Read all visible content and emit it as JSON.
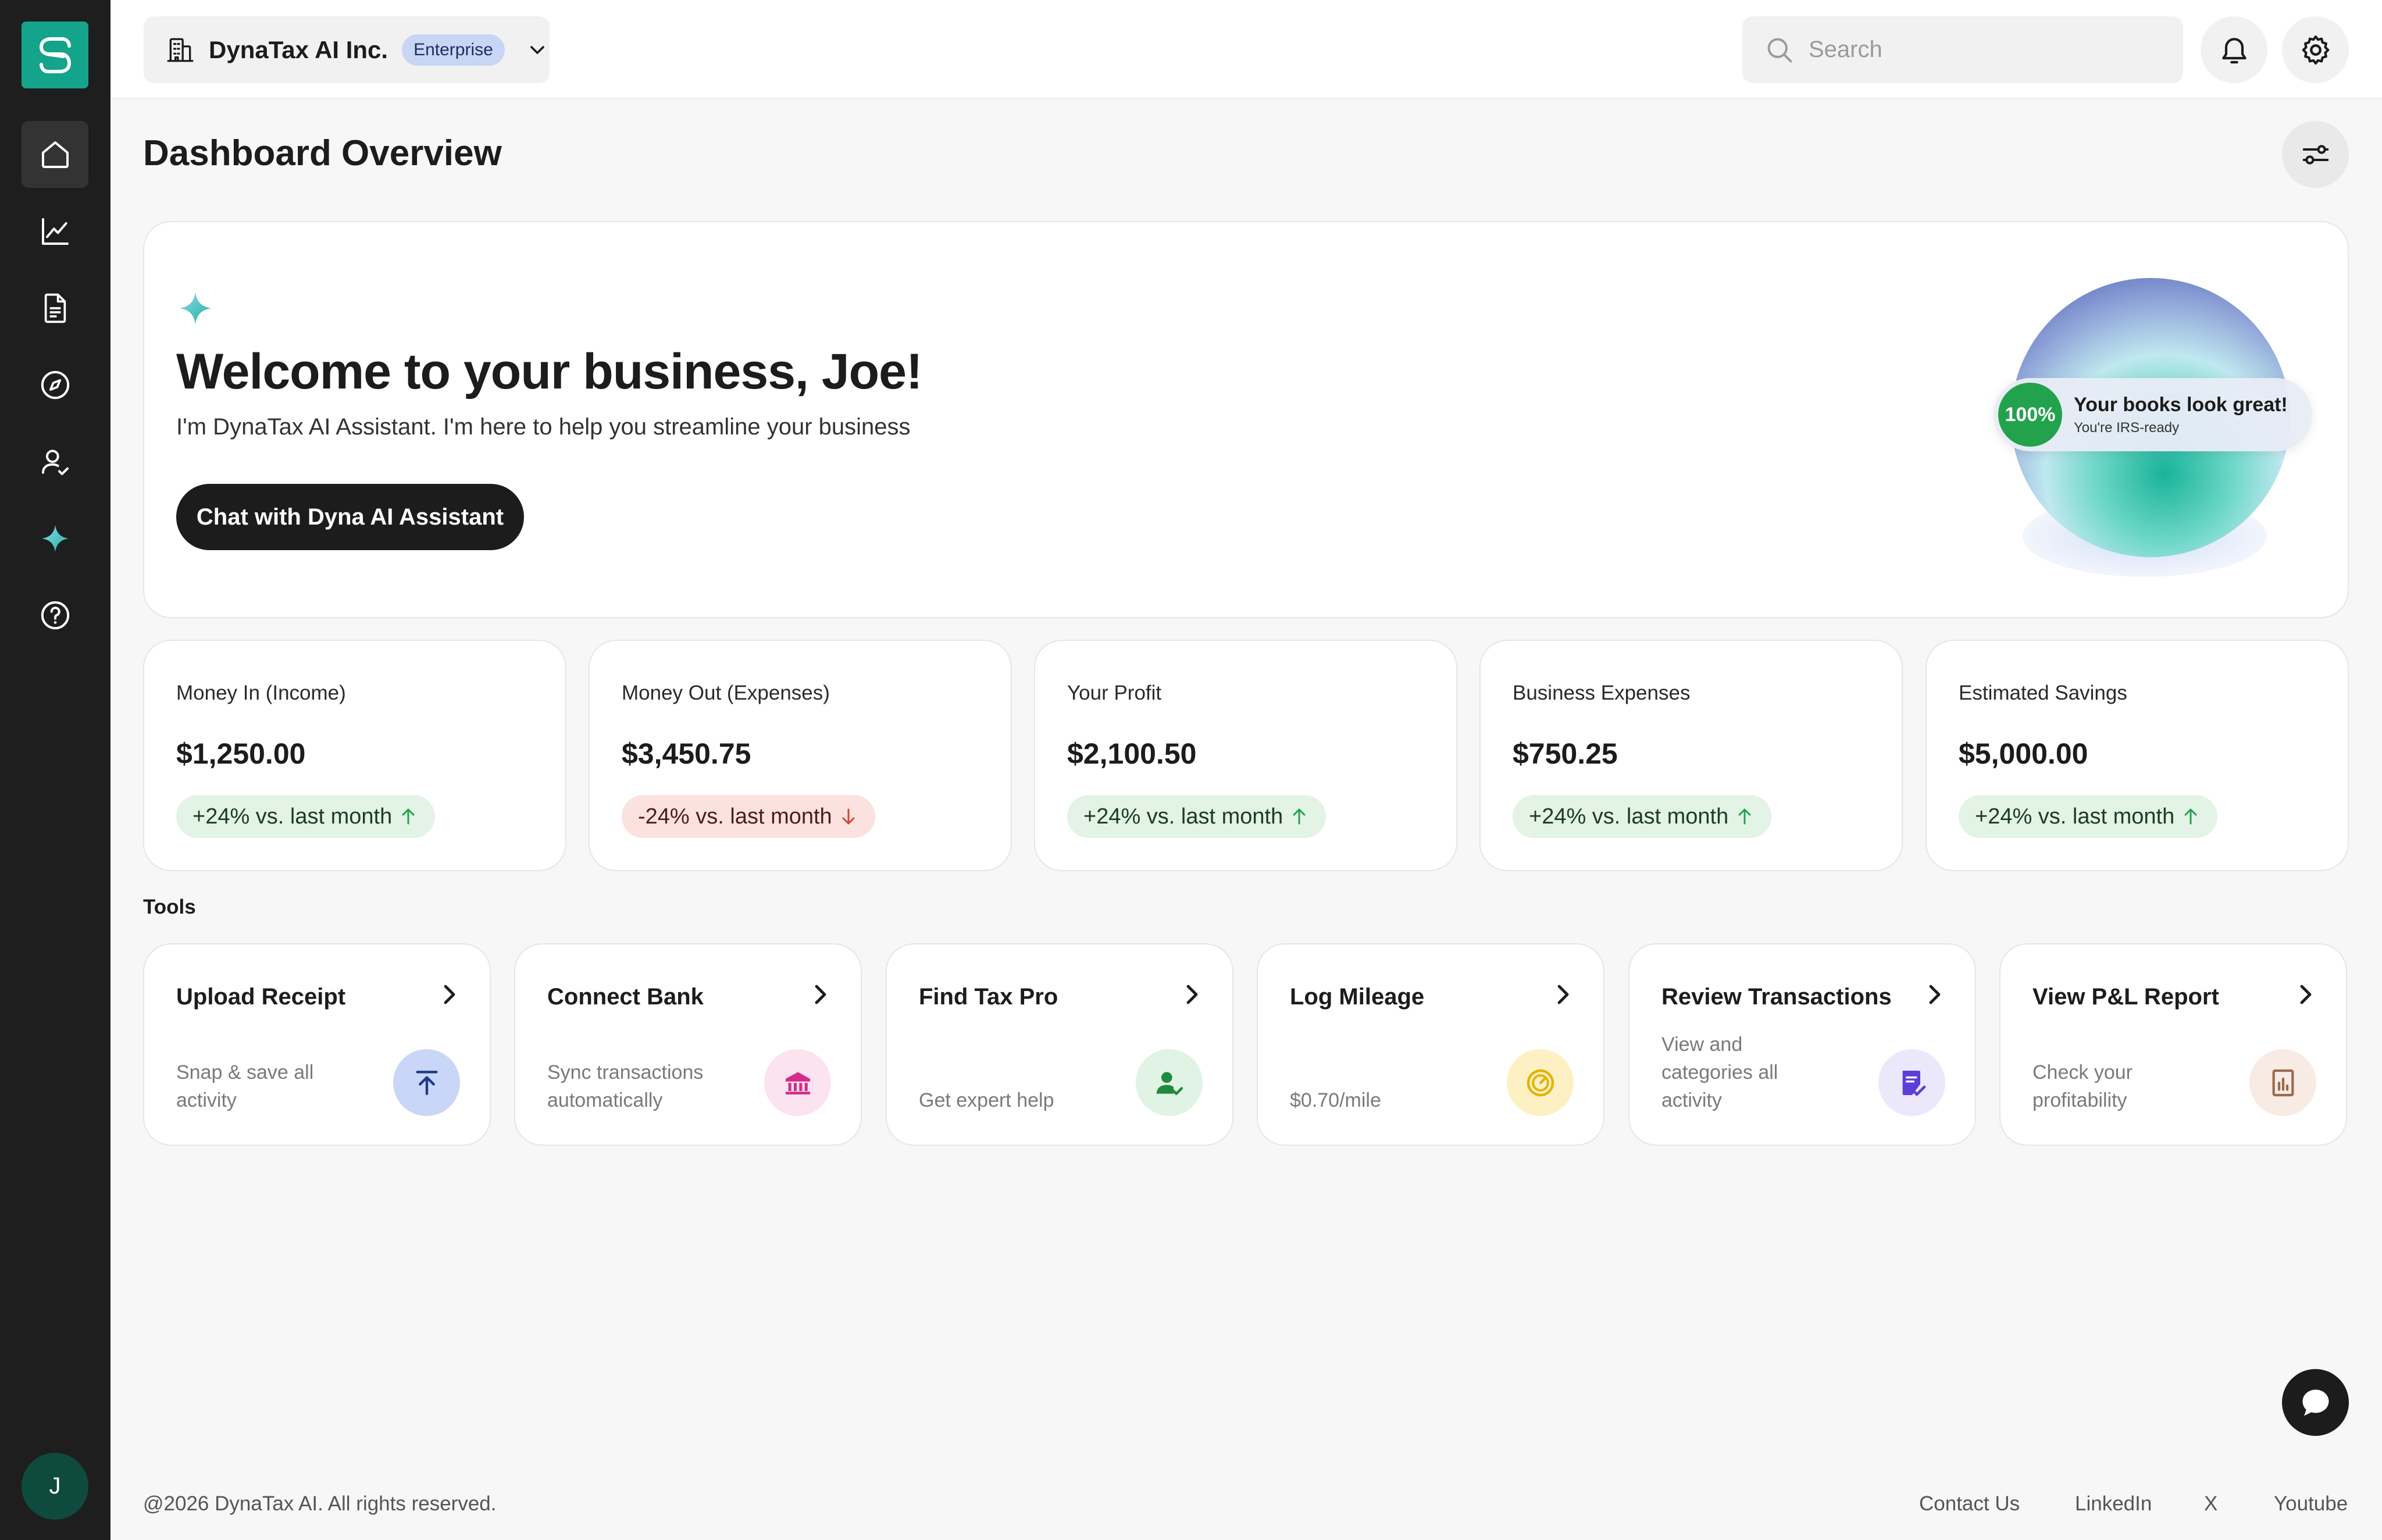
{
  "org": {
    "name": "DynaTax AI Inc.",
    "plan": "Enterprise"
  },
  "search": {
    "placeholder": "Search"
  },
  "page": {
    "title": "Dashboard Overview"
  },
  "hero": {
    "title": "Welcome to your business, Joe!",
    "subtitle": "I'm DynaTax AI Assistant. I'm here to help you streamline your business",
    "cta": "Chat with Dyna AI Assistant",
    "status_percent": "100%",
    "status_title": "Your books look great!",
    "status_subtitle": "You're IRS-ready"
  },
  "stats": [
    {
      "label": "Money In (Income)",
      "value": "$1,250.00",
      "change": "+24% vs. last month",
      "trend": "up"
    },
    {
      "label": "Money Out (Expenses)",
      "value": "$3,450.75",
      "change": "-24% vs. last month",
      "trend": "down"
    },
    {
      "label": "Your Profit",
      "value": "$2,100.50",
      "change": "+24% vs. last month",
      "trend": "up"
    },
    {
      "label": "Business Expenses",
      "value": "$750.25",
      "change": "+24% vs. last month",
      "trend": "up"
    },
    {
      "label": "Estimated Savings",
      "value": "$5,000.00",
      "change": "+24% vs. last month",
      "trend": "up"
    }
  ],
  "tools": {
    "heading": "Tools",
    "items": [
      {
        "title": "Upload Receipt",
        "desc": "Snap & save all activity",
        "icon": "upload-icon",
        "color": "#c9d6f7"
      },
      {
        "title": "Connect Bank",
        "desc": "Sync transactions automatically",
        "icon": "bank-icon",
        "color": "#fbe3ef"
      },
      {
        "title": "Find Tax Pro",
        "desc": "Get expert help",
        "icon": "user-check-icon",
        "color": "#e1f3e4"
      },
      {
        "title": "Log Mileage",
        "desc": "$0.70/mile",
        "icon": "gauge-icon",
        "color": "#fdf1c4"
      },
      {
        "title": "Review Transactions",
        "desc": "View and categories all activity",
        "icon": "document-check-icon",
        "color": "#ece8fb"
      },
      {
        "title": "View P&L Report",
        "desc": "Check your profitability",
        "icon": "report-icon",
        "color": "#f7ebe4"
      }
    ]
  },
  "user": {
    "initial": "J"
  },
  "footer": {
    "copyright": "@2026 DynaTax AI. All rights reserved.",
    "links": [
      "Contact Us",
      "LinkedIn",
      "X",
      "Youtube"
    ]
  },
  "colors": {
    "brand": "#14a48c",
    "sidebar": "#1e1e1e",
    "positive": "#23a24d",
    "negative": "#d0453a"
  }
}
